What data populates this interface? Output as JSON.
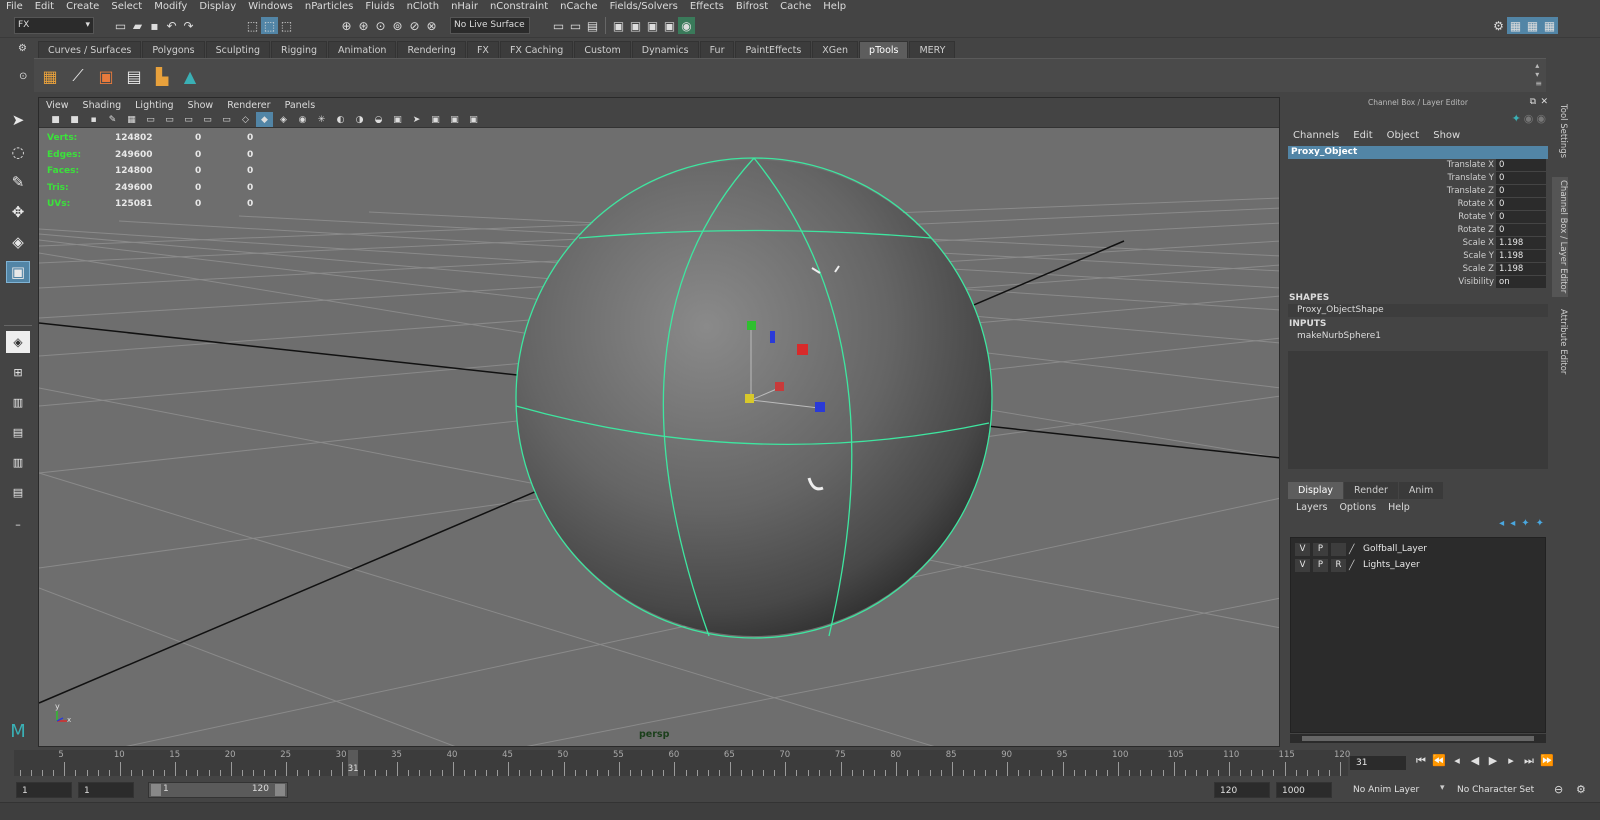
{
  "menubar": [
    "File",
    "Edit",
    "Create",
    "Select",
    "Modify",
    "Display",
    "Windows",
    "nParticles",
    "Fluids",
    "nCloth",
    "nHair",
    "nConstraint",
    "nCache",
    "Fields/Solvers",
    "Effects",
    "Bifrost",
    "Cache",
    "Help"
  ],
  "status": {
    "menuset": "FX",
    "live_surface": "No Live Surface"
  },
  "shelf_tabs": [
    "Curves / Surfaces",
    "Polygons",
    "Sculpting",
    "Rigging",
    "Animation",
    "Rendering",
    "FX",
    "FX Caching",
    "Custom",
    "Dynamics",
    "Fur",
    "PaintEffects",
    "XGen",
    "pTools",
    "MERY"
  ],
  "viewport": {
    "menu": [
      "View",
      "Shading",
      "Lighting",
      "Show",
      "Renderer",
      "Panels"
    ],
    "hud": [
      {
        "label": "Verts:",
        "v1": "124802",
        "v2": "0",
        "v3": "0"
      },
      {
        "label": "Edges:",
        "v1": "249600",
        "v2": "0",
        "v3": "0"
      },
      {
        "label": "Faces:",
        "v1": "124800",
        "v2": "0",
        "v3": "0"
      },
      {
        "label": "Tris:",
        "v1": "249600",
        "v2": "0",
        "v3": "0"
      },
      {
        "label": "UVs:",
        "v1": "125081",
        "v2": "0",
        "v3": "0"
      }
    ],
    "camera": "persp",
    "axis_y": "y",
    "axis_x": "x"
  },
  "channel_box": {
    "header": "Channel Box / Layer Editor",
    "menu": [
      "Channels",
      "Edit",
      "Object",
      "Show"
    ],
    "object": "Proxy_Object",
    "channels": [
      {
        "label": "Translate X",
        "value": "0"
      },
      {
        "label": "Translate Y",
        "value": "0"
      },
      {
        "label": "Translate Z",
        "value": "0"
      },
      {
        "label": "Rotate X",
        "value": "0"
      },
      {
        "label": "Rotate Y",
        "value": "0"
      },
      {
        "label": "Rotate Z",
        "value": "0"
      },
      {
        "label": "Scale X",
        "value": "1.198"
      },
      {
        "label": "Scale Y",
        "value": "1.198"
      },
      {
        "label": "Scale Z",
        "value": "1.198"
      },
      {
        "label": "Visibility",
        "value": "on"
      }
    ],
    "shapes_label": "SHAPES",
    "shape_item": "Proxy_ObjectShape",
    "inputs_label": "INPUTS",
    "input_item": "makeNurbSphere1"
  },
  "layer_editor": {
    "tabs": [
      "Display",
      "Render",
      "Anim"
    ],
    "menu": [
      "Layers",
      "Options",
      "Help"
    ],
    "layers": [
      {
        "v": "V",
        "p": "P",
        "r": "",
        "name": "Golfball_Layer"
      },
      {
        "v": "V",
        "p": "P",
        "r": "R",
        "name": "Lights_Layer"
      }
    ]
  },
  "side_tabs": [
    "Tool Settings",
    "Channel Box / Layer Editor",
    "Attribute Editor"
  ],
  "timeline": {
    "ticks": [
      "5",
      "10",
      "15",
      "20",
      "25",
      "30",
      "35",
      "40",
      "45",
      "50",
      "55",
      "60",
      "65",
      "70",
      "75",
      "80",
      "85",
      "90",
      "95",
      "100",
      "105",
      "110",
      "115",
      "120"
    ],
    "current_marker": "31",
    "current_frame": "31"
  },
  "range": {
    "start": "1",
    "start2": "1",
    "slider_start": "1",
    "slider_end": "120",
    "end": "120",
    "end2": "1000",
    "anim_layer": "No Anim Layer",
    "char_set": "No Character Set"
  },
  "colors": {
    "accent": "#5285a6",
    "wire": "#3ee6a0",
    "hud_label": "#3be23b",
    "viewport_bg": "#6e6e6e"
  }
}
